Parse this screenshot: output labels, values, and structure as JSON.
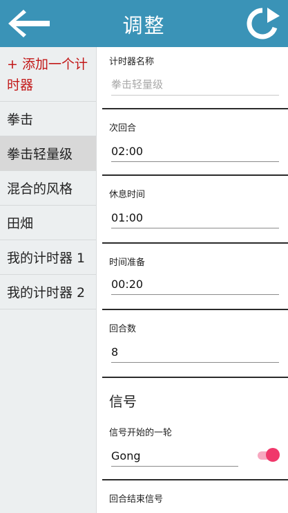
{
  "header": {
    "title": "调整",
    "back_icon": "arrow-left-icon",
    "refresh_icon": "refresh-icon",
    "color": "#3a93b7"
  },
  "sidebar": {
    "add_label": "+ 添加一个计时器",
    "items": [
      "拳击",
      "拳击轻量级",
      "混合的风格",
      "田畑",
      "我的计时器 1",
      "我的计时器 2"
    ],
    "selected": "拳击轻量级"
  },
  "form": {
    "timer_name": {
      "label": "计时器名称",
      "placeholder": "拳击轻量级"
    },
    "round": {
      "label": "次回合",
      "value": "02:00"
    },
    "rest": {
      "label": "休息时间",
      "value": "01:00"
    },
    "prep": {
      "label": "时间准备",
      "value": "00:20"
    },
    "rounds": {
      "label": "回合数",
      "value": "8"
    },
    "signal_section": "信号",
    "round_start_signal": {
      "label": "信号开始的一轮",
      "value": "Gong",
      "toggle_on": true
    },
    "round_end_signal": {
      "label": "回合结束信号"
    }
  },
  "colors": {
    "accent_add": "#c21818",
    "toggle": "#f0386b"
  }
}
